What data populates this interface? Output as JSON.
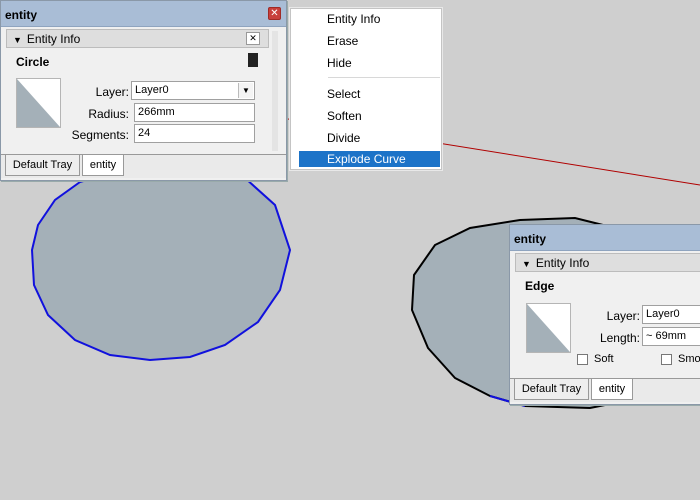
{
  "tray_left": {
    "title": "entity",
    "panel_title": "Entity Info",
    "entity_type": "Circle",
    "fields": [
      {
        "label": "Layer:",
        "value": "Layer0"
      },
      {
        "label": "Radius:",
        "value": "266mm"
      },
      {
        "label": "Segments:",
        "value": "24"
      }
    ],
    "tabs": [
      "Default Tray",
      "entity"
    ]
  },
  "context_menu": {
    "items": [
      "Entity Info",
      "Erase",
      "Hide",
      "Select",
      "Soften",
      "Divide",
      "Explode Curve"
    ],
    "highlighted": "Explode Curve"
  },
  "tray_right": {
    "title": "entity",
    "panel_title": "Entity Info",
    "entity_type": "Edge",
    "fields": [
      {
        "label": "Layer:",
        "value": "Layer0"
      },
      {
        "label": "Length:",
        "value": "~ 69mm"
      }
    ],
    "checkboxes": [
      "Soft",
      "Smo"
    ],
    "tabs": [
      "Default Tray",
      "entity"
    ]
  },
  "colors": {
    "background": "#cfcfcf",
    "circle_fill": "#a4b0b8",
    "selected_edge": "#1111dd",
    "edge": "#000000",
    "axis_red": "#b00000",
    "menu_highlight": "#1c73c8",
    "titlebar": "#a9bdd6"
  },
  "icons": [
    "close-icon",
    "triangle-down-icon",
    "pin-icon",
    "dropdown-arrow-icon"
  ]
}
